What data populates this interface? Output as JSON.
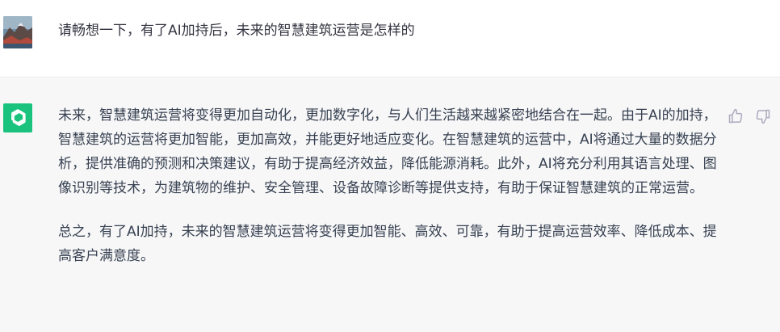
{
  "user_message": {
    "avatar": "landscape-photo-avatar",
    "text": "请畅想一下，有了AI加持后，未来的智慧建筑运营是怎样的"
  },
  "assistant_message": {
    "avatar": "openai-logo-icon",
    "paragraphs": [
      "未来，智慧建筑运营将变得更加自动化，更加数字化，与人们生活越来越紧密地结合在一起。由于AI的加持，智慧建筑的运营将更加智能，更加高效，并能更好地适应变化。在智慧建筑的运营中，AI将通过大量的数据分析，提供准确的预测和决策建议，有助于提高经济效益，降低能源消耗。此外，AI将充分利用其语言处理、图像识别等技术，为建筑物的维护、安全管理、设备故障诊断等提供支持，有助于保证智慧建筑的正常运营。",
      "总之，有了AI加持，未来的智慧建筑运营将变得更加智能、高效、可靠，有助于提高运营效率、降低成本、提高客户满意度。"
    ],
    "actions": {
      "thumbs_up": "thumbs-up-icon",
      "thumbs_down": "thumbs-down-icon"
    }
  },
  "colors": {
    "assistant_bg": "#f7f7f8",
    "gpt_green": "#19c37d",
    "text": "#374151",
    "icon_gray": "#acacbe"
  }
}
